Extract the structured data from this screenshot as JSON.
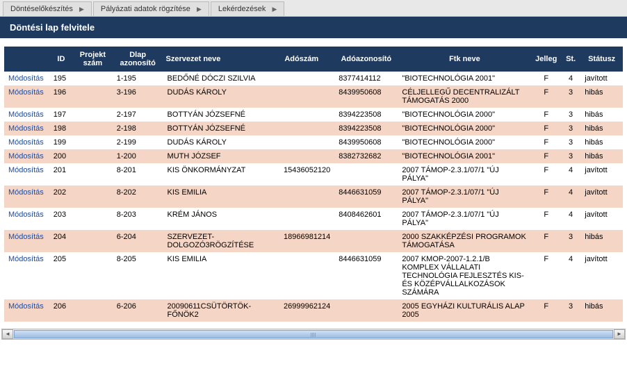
{
  "tabs": [
    {
      "label": "Döntéselőkészítés"
    },
    {
      "label": "Pályázati adatok rögzítése"
    },
    {
      "label": "Lekérdezések"
    }
  ],
  "title": "Döntési lap felvitele",
  "headers": {
    "action": "",
    "id": "ID",
    "projektszam": "Projekt szám",
    "dlap": "Dlap azonosító",
    "szervezet": "Szervezet neve",
    "adoszam": "Adószám",
    "adoazonosito": "Adóazonosító",
    "ftk": "Ftk neve",
    "jelleg": "Jelleg",
    "st": "St.",
    "statusz": "Státusz"
  },
  "action_label": "Módosítás",
  "rows": [
    {
      "id": "195",
      "projektszam": "",
      "dlap": "1-195",
      "szervezet": "BEDŐNÉ DÓCZI SZILVIA",
      "adoszam": "",
      "adoazonosito": "8377414112",
      "ftk": "\"BIOTECHNOLÓGIA 2001\"",
      "jelleg": "F",
      "st": "4",
      "statusz": "javított"
    },
    {
      "id": "196",
      "projektszam": "",
      "dlap": "3-196",
      "szervezet": "DUDÁS KÁROLY",
      "adoszam": "",
      "adoazonosito": "8439950608",
      "ftk": "CÉLJELLEGŰ DECENTRALIZÁLT TÁMOGATÁS 2000",
      "jelleg": "F",
      "st": "3",
      "statusz": "hibás"
    },
    {
      "id": "197",
      "projektszam": "",
      "dlap": "2-197",
      "szervezet": "BOTTYÁN JÓZSEFNÉ",
      "adoszam": "",
      "adoazonosito": "8394223508",
      "ftk": "\"BIOTECHNOLÓGIA 2000\"",
      "jelleg": "F",
      "st": "3",
      "statusz": "hibás"
    },
    {
      "id": "198",
      "projektszam": "",
      "dlap": "2-198",
      "szervezet": "BOTTYÁN JÓZSEFNÉ",
      "adoszam": "",
      "adoazonosito": "8394223508",
      "ftk": "\"BIOTECHNOLÓGIA 2000\"",
      "jelleg": "F",
      "st": "3",
      "statusz": "hibás"
    },
    {
      "id": "199",
      "projektszam": "",
      "dlap": "2-199",
      "szervezet": "DUDÁS KÁROLY",
      "adoszam": "",
      "adoazonosito": "8439950608",
      "ftk": "\"BIOTECHNOLÓGIA 2000\"",
      "jelleg": "F",
      "st": "3",
      "statusz": "hibás"
    },
    {
      "id": "200",
      "projektszam": "",
      "dlap": "1-200",
      "szervezet": "MUTH JÓZSEF",
      "adoszam": "",
      "adoazonosito": "8382732682",
      "ftk": "\"BIOTECHNOLÓGIA 2001\"",
      "jelleg": "F",
      "st": "3",
      "statusz": "hibás"
    },
    {
      "id": "201",
      "projektszam": "",
      "dlap": "8-201",
      "szervezet": "KIS ÖNKORMÁNYZAT",
      "adoszam": "15436052120",
      "adoazonosito": "",
      "ftk": "2007 TÁMOP-2.3.1/07/1 \"ÚJ PÁLYA\"",
      "jelleg": "F",
      "st": "4",
      "statusz": "javított"
    },
    {
      "id": "202",
      "projektszam": "",
      "dlap": "8-202",
      "szervezet": "KIS EMILIA",
      "adoszam": "",
      "adoazonosito": "8446631059",
      "ftk": "2007 TÁMOP-2.3.1/07/1 \"ÚJ PÁLYA\"",
      "jelleg": "F",
      "st": "4",
      "statusz": "javított"
    },
    {
      "id": "203",
      "projektszam": "",
      "dlap": "8-203",
      "szervezet": "KRÉM JÁNOS",
      "adoszam": "",
      "adoazonosito": "8408462601",
      "ftk": "2007 TÁMOP-2.3.1/07/1 \"ÚJ PÁLYA\"",
      "jelleg": "F",
      "st": "4",
      "statusz": "javított"
    },
    {
      "id": "204",
      "projektszam": "",
      "dlap": "6-204",
      "szervezet": "SZERVEZET-DOLGOZÓ3RÖGZÍTÉSE",
      "adoszam": "18966981214",
      "adoazonosito": "",
      "ftk": "2000 SZAKKÉPZÉSI PROGRAMOK TÁMOGATÁSA",
      "jelleg": "F",
      "st": "3",
      "statusz": "hibás"
    },
    {
      "id": "205",
      "projektszam": "",
      "dlap": "8-205",
      "szervezet": "KIS EMILIA",
      "adoszam": "",
      "adoazonosito": "8446631059",
      "ftk": "2007 KMOP-2007-1.2.1/B KOMPLEX VÁLLALATI TECHNOLÓGIA FEJLESZTÉS KIS- ÉS KÖZÉPVÁLLALKOZÁSOK SZÁMÁRA",
      "jelleg": "F",
      "st": "4",
      "statusz": "javított"
    },
    {
      "id": "206",
      "projektszam": "",
      "dlap": "6-206",
      "szervezet": "20090611CSÜTÖRTÖK-FŐNÖK2",
      "adoszam": "26999962124",
      "adoazonosito": "",
      "ftk": "2005 EGYHÁZI KULTURÁLIS ALAP 2005",
      "jelleg": "F",
      "st": "3",
      "statusz": "hibás"
    }
  ]
}
